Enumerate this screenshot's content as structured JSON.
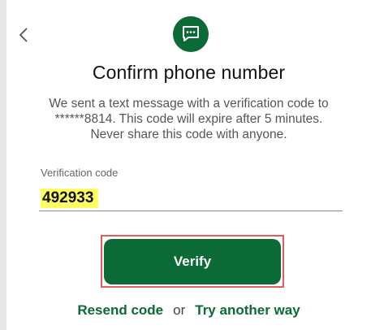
{
  "header": {
    "back_icon": "chevron-left-icon",
    "badge_icon": "chat-bubble-icon"
  },
  "title": "Confirm phone number",
  "message": {
    "line1": "We sent a text message with a verification code to",
    "line2": "******8814. This code will expire after 5 minutes.",
    "line3": "Never share this code with anyone."
  },
  "field": {
    "label": "Verification code",
    "value": "492933"
  },
  "verify_label": "Verify",
  "links": {
    "resend": "Resend code",
    "or": "or",
    "another": "Try another way"
  },
  "colors": {
    "accent": "#0b6a35",
    "highlight": "#ffff60",
    "annotation": "#e35d5d"
  }
}
